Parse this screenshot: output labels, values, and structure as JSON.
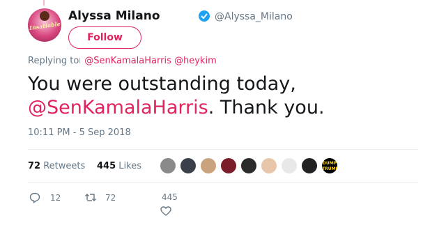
{
  "user": {
    "display_name": "Alyssa Milano",
    "handle": "@Alyssa_Milano",
    "avatar_text": "Insatiable",
    "verified_icon": "verified-badge-icon"
  },
  "follow_label": "Follow",
  "replying": {
    "prefix": "Replying to",
    "mention1": "@SenKamalaHarris",
    "mention2": "@heykim"
  },
  "tweet": {
    "line1": "You were outstanding today,",
    "mention": "@SenKamalaHarris",
    "line2_suffix": ". Thank you."
  },
  "timestamp": "10:11 PM - 5 Sep 2018",
  "stats": {
    "retweets_count": "72",
    "retweets_label": "Retweets",
    "likes_count": "445",
    "likes_label": "Likes"
  },
  "likers": {
    "avatar_colors": [
      "#8a8a8a",
      "#3a3f4a",
      "#c9a37e",
      "#7a1f2a",
      "#2b2b2b",
      "#e8c6a9",
      "#e8e8e8",
      "#aab2bd",
      "#222222",
      "#000000"
    ],
    "dump_line1": "DUMP",
    "dump_line2": "TRUMP"
  },
  "actions": {
    "reply_count": "12",
    "retweet_count": "72",
    "like_count": "445"
  },
  "colors": {
    "accent": "#e0245e",
    "secondary_text": "#657786",
    "verified": "#1da1f2"
  }
}
